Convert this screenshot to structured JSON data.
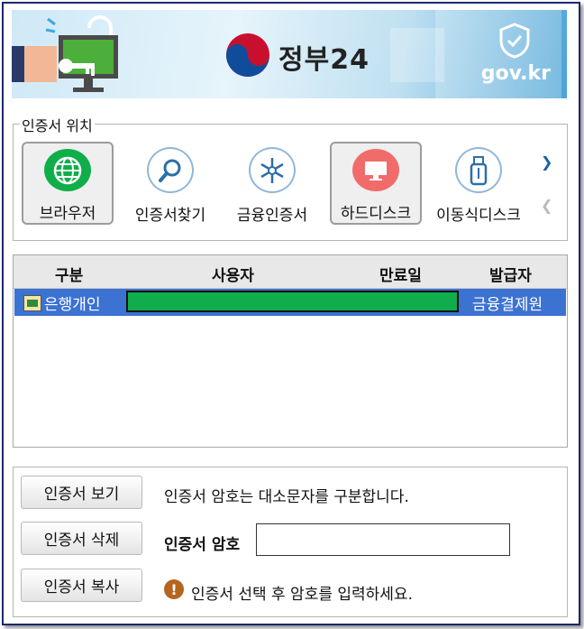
{
  "banner": {
    "title": "정부24",
    "gov": "gov.kr"
  },
  "location": {
    "legend": "인증서 위치",
    "items": [
      {
        "label": "브라우저",
        "icon": "globe-icon",
        "selected": true
      },
      {
        "label": "인증서찾기",
        "icon": "search-icon",
        "selected": false
      },
      {
        "label": "금융인증서",
        "icon": "financial-cert-icon",
        "selected": false
      },
      {
        "label": "하드디스크",
        "icon": "monitor-icon",
        "selected": true
      },
      {
        "label": "이동식디스크",
        "icon": "usb-icon",
        "selected": false
      }
    ]
  },
  "table": {
    "headers": [
      "구분",
      "사용자",
      "만료일",
      "발급자"
    ],
    "rows": [
      {
        "category": "은행개인",
        "issuer": "금융결제원"
      }
    ]
  },
  "buttons": {
    "view": "인증서 보기",
    "delete": "인증서 삭제",
    "copy": "인증서 복사"
  },
  "messages": {
    "case_note": "인증서 암호는 대소문자를 구분합니다.",
    "password_label": "인증서 암호",
    "password_value": "",
    "hint": "인증서 선택 후 암호를 입력하세요."
  },
  "colors": {
    "selected_row": "#3c72d1",
    "mask_green": "#0fad4b",
    "banner_blue": "#4aa3d6"
  }
}
